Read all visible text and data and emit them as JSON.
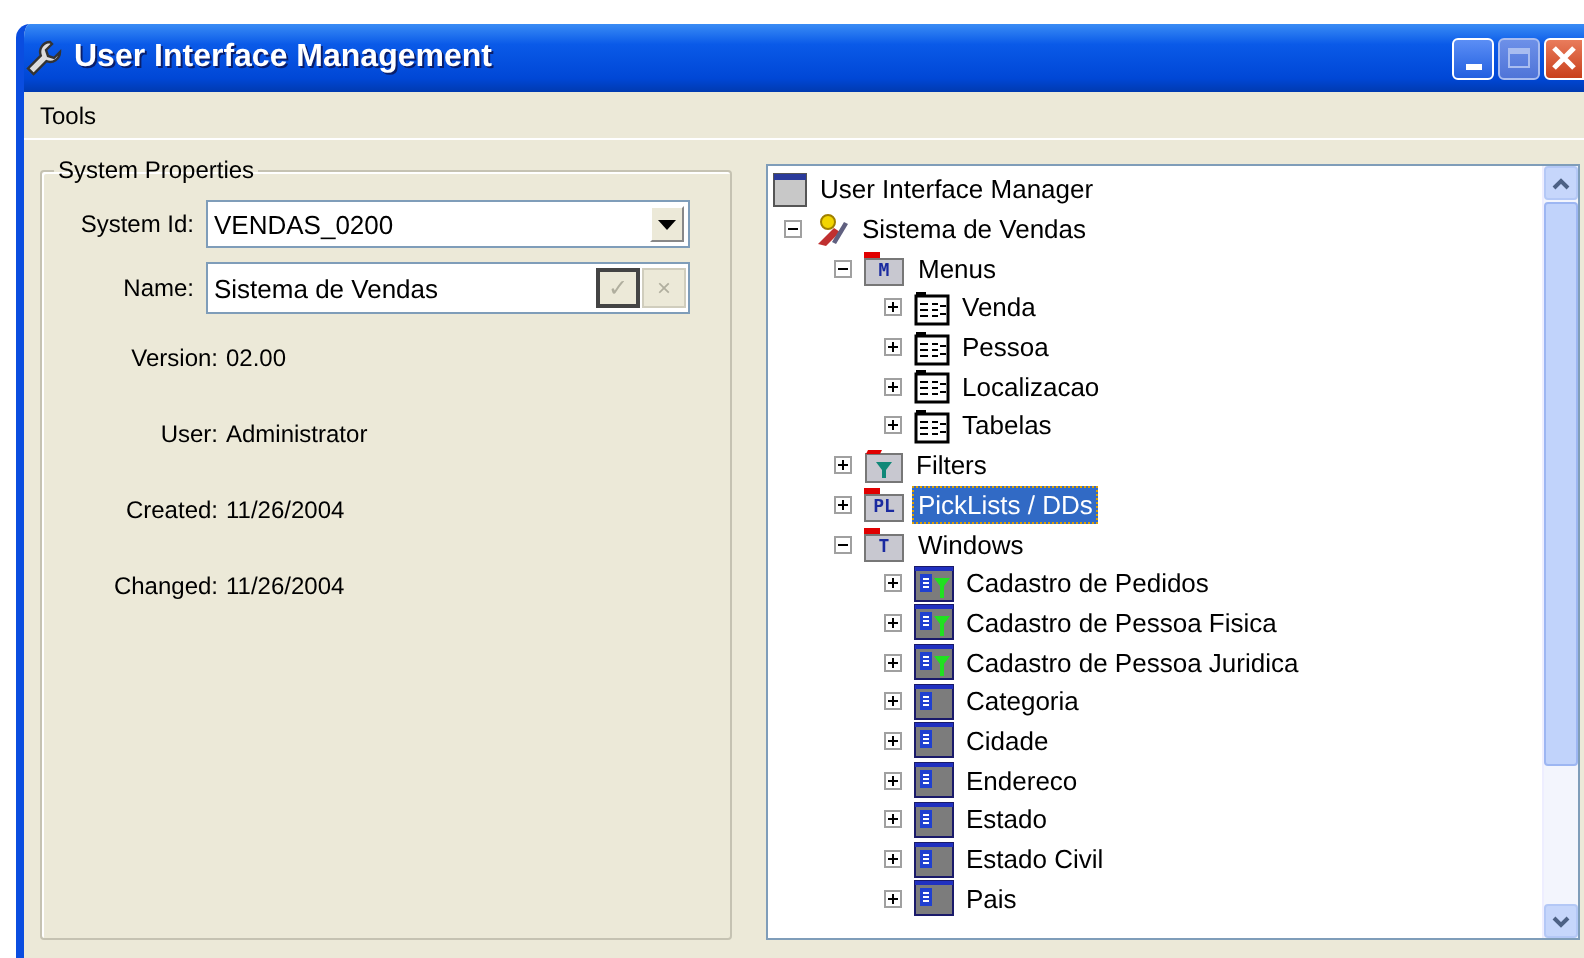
{
  "window": {
    "title": "User Interface Management"
  },
  "menu": [
    "Tools"
  ],
  "properties": {
    "title": "System Properties",
    "system_id": {
      "label": "System Id:",
      "value": "VENDAS_0200"
    },
    "name": {
      "label": "Name:",
      "value": "Sistema de Vendas",
      "accept": "✓",
      "cancel": "×"
    },
    "fields": [
      {
        "label": "Version:",
        "value": "02.00"
      },
      {
        "label": "User:",
        "value": "Administrator"
      },
      {
        "label": "Created:",
        "value": "11/26/2004"
      },
      {
        "label": "Changed:",
        "value": "11/26/2004"
      }
    ]
  },
  "tree": [
    {
      "label": "User Interface Manager",
      "kind": "root",
      "selected": false,
      "children": [
        {
          "label": "Sistema de Vendas",
          "kind": "system",
          "expanded": true,
          "selected": false,
          "children": [
            {
              "label": "Menus",
              "kind": "folder",
              "badge": "M",
              "expanded": true,
              "selected": false,
              "children": [
                {
                  "label": "Venda",
                  "kind": "menu",
                  "expanded": false,
                  "selected": false
                },
                {
                  "label": "Pessoa",
                  "kind": "menu",
                  "expanded": false,
                  "selected": false
                },
                {
                  "label": "Localizacao",
                  "kind": "menu",
                  "expanded": false,
                  "selected": false
                },
                {
                  "label": "Tabelas",
                  "kind": "menu",
                  "expanded": false,
                  "selected": false
                }
              ]
            },
            {
              "label": "Filters",
              "kind": "filter-folder",
              "expanded": false,
              "selected": false
            },
            {
              "label": "PickLists / DDs",
              "kind": "folder",
              "badge": "PL",
              "expanded": false,
              "selected": true
            },
            {
              "label": "Windows",
              "kind": "folder",
              "badge": "T",
              "expanded": true,
              "selected": false,
              "children": [
                {
                  "label": "Cadastro de Pedidos",
                  "kind": "window-filtered",
                  "expanded": false,
                  "selected": false
                },
                {
                  "label": "Cadastro de Pessoa Fisica",
                  "kind": "window-filtered",
                  "expanded": false,
                  "selected": false
                },
                {
                  "label": "Cadastro de Pessoa Juridica",
                  "kind": "window-filtered",
                  "expanded": false,
                  "selected": false
                },
                {
                  "label": "Categoria",
                  "kind": "window",
                  "expanded": false,
                  "selected": false
                },
                {
                  "label": "Cidade",
                  "kind": "window",
                  "expanded": false,
                  "selected": false
                },
                {
                  "label": "Endereco",
                  "kind": "window",
                  "expanded": false,
                  "selected": false
                },
                {
                  "label": "Estado",
                  "kind": "window",
                  "expanded": false,
                  "selected": false
                },
                {
                  "label": "Estado Civil",
                  "kind": "window",
                  "expanded": false,
                  "selected": false
                },
                {
                  "label": "Pais",
                  "kind": "window",
                  "expanded": false,
                  "selected": false
                }
              ]
            }
          ]
        }
      ]
    }
  ]
}
